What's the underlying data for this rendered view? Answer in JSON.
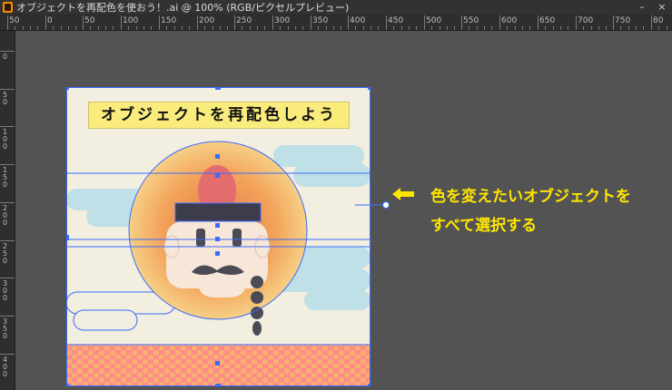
{
  "window": {
    "document_title": "オブジェクトを再配色を使おう！.ai @ 100% (RGB/ピクセルプレビュー)",
    "minimize_glyph": "–",
    "close_glyph": "×"
  },
  "ruler": {
    "h_labels": [
      "50",
      "0",
      "50",
      "100",
      "150",
      "200",
      "250",
      "300",
      "350",
      "400",
      "450",
      "500",
      "550",
      "600",
      "650",
      "700",
      "750",
      "80"
    ],
    "v_labels": [
      "0",
      "50",
      "100",
      "150",
      "200",
      "250",
      "300",
      "350",
      "400",
      "41"
    ]
  },
  "artwork": {
    "title": "オブジェクトを再配色しよう",
    "colors": {
      "background": "#f2eee0",
      "banner": "#f9ec7d",
      "sun_outer": "#f3b867",
      "sun_inner": "#e8764a",
      "cloud": "#bfe0e6",
      "face": "#f7e7d9",
      "hat": "#e36d6d",
      "hat_band": "#3c3c4a",
      "mustache": "#4b4b55",
      "floor": "#ff8a8a",
      "selection": "#3b6cff"
    }
  },
  "annotation": {
    "arrow_icon": "left-arrow-icon",
    "line1": "色を変えたいオブジェクトを",
    "line2": "すべて選択する",
    "color": "#ffe600"
  }
}
